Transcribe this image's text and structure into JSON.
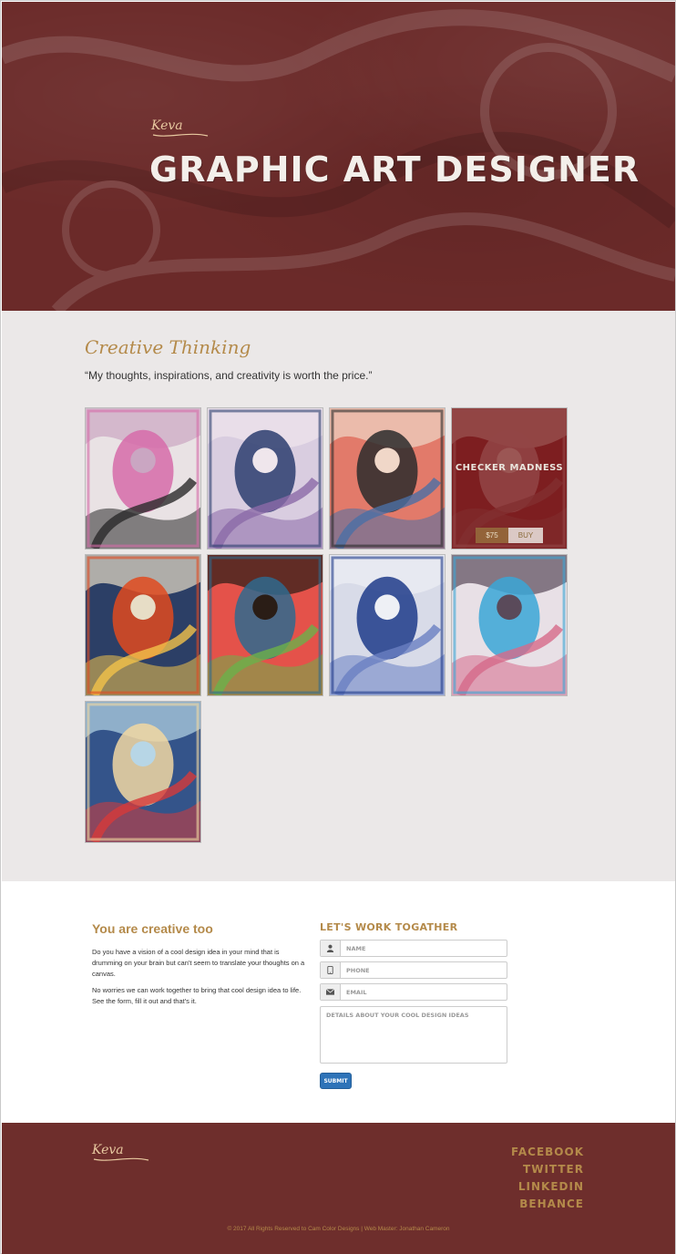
{
  "hero": {
    "logo": "Keva",
    "title": "GRAPHIC ART DESIGNER"
  },
  "gallery": {
    "heading": "Creative Thinking",
    "quote": "“My thoughts, inspirations, and creativity is worth the price.”",
    "items": [
      {
        "palette": [
          "#e9e2e4",
          "#d66ba9",
          "#2a2a2a",
          "#caa6c2"
        ]
      },
      {
        "palette": [
          "#d9cde0",
          "#2c3d6e",
          "#8b6aa8",
          "#efe6ec"
        ]
      },
      {
        "palette": [
          "#e27a6a",
          "#2c2c2c",
          "#4b6fa5",
          "#f0d7c8"
        ]
      },
      {
        "palette": [
          "#7d1e20",
          "#c9a8a8",
          "#8f5a5a",
          "#e9e4dc"
        ],
        "overlay": {
          "title": "CHECKER MADNESS",
          "price": "$75",
          "buy": "BUY"
        }
      },
      {
        "palette": [
          "#2c3f66",
          "#e14a1f",
          "#f3c24a",
          "#e7ddc6"
        ]
      },
      {
        "palette": [
          "#e4524a",
          "#2f6a8e",
          "#6bb04a",
          "#2a1d16"
        ]
      },
      {
        "palette": [
          "#d8dbe8",
          "#1f3b8a",
          "#6a7fc2",
          "#eef0f5"
        ]
      },
      {
        "palette": [
          "#e8e0e6",
          "#3aa6d6",
          "#d66a8a",
          "#5a4a5a"
        ]
      },
      {
        "palette": [
          "#34548a",
          "#f2d8a2",
          "#d63a3a",
          "#b7d6e6"
        ]
      }
    ]
  },
  "contact": {
    "heading": "You are creative too",
    "para1": "Do you have a vision of a cool design idea in your mind that is drumming on your brain but can't seem to translate your thoughts on a canvas.",
    "para2": "No worries we can work together to bring that cool design idea to life. See the form, fill it out and that's it.",
    "form": {
      "heading": "LET'S WORK TOGATHER",
      "name_placeholder": "NAME",
      "phone_placeholder": "PHONE",
      "email_placeholder": "EMAIL",
      "details_placeholder": "DETAILS ABOUT YOUR COOL DESIGN IDEAS",
      "submit_label": "SUBMIT"
    }
  },
  "footer": {
    "logo": "Keva",
    "social": [
      "FACEBOOK",
      "TWITTER",
      "LINKEDIN",
      "BEHANCE"
    ],
    "copyright": "© 2017 All Rights Reserved to Cam Color Designs | Web Master: Jonathan Cameron"
  },
  "colors": {
    "brand_maroon": "#6b2a29",
    "accent_gold": "#b48a4a",
    "section_bg": "#ebe8e8",
    "submit_blue": "#2e73b8"
  },
  "icons": {
    "name": "user-icon",
    "phone": "phone-icon",
    "email": "envelope-icon"
  }
}
